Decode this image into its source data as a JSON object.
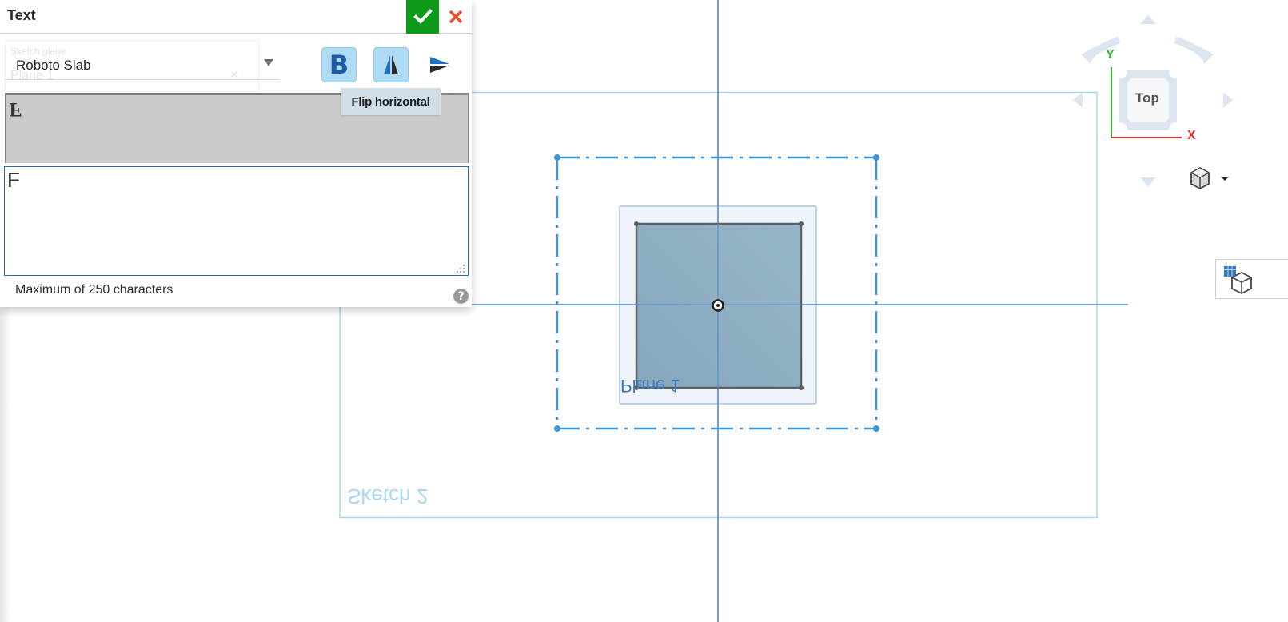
{
  "panel": {
    "title": "Text",
    "accept_icon": "checkmark-icon",
    "cancel_icon": "close-icon",
    "ghost_field": {
      "label": "Sketch plane",
      "value": "Plane 1"
    },
    "font_select": {
      "value": "Roboto Slab"
    },
    "toolbar": {
      "bold_label": "B",
      "bold_active": true,
      "flip_horizontal_active": true,
      "flip_vertical_active": false,
      "icons": [
        "bold-icon",
        "flip-horizontal-icon",
        "flip-vertical-icon"
      ]
    },
    "tooltip": "Flip horizontal",
    "preview_text": "F",
    "text_input": {
      "value": "F"
    },
    "hint": "Maximum of 250 characters",
    "help_label": "?"
  },
  "canvas": {
    "plane_label": "Plane 1",
    "sketch_label": "Sketch 2",
    "colors": {
      "axis": "#5a8fcf",
      "sketch_outline": "#a9d7f2",
      "construction": "#3b97d3",
      "face_fill": "#8eafc4",
      "face_edge": "#5c6064"
    }
  },
  "view_cube": {
    "face_label": "Top",
    "axis_x": "X",
    "axis_y": "Y",
    "colors": {
      "x": "#e03030",
      "y": "#2fb52f",
      "cube": "#dde5ee"
    }
  }
}
